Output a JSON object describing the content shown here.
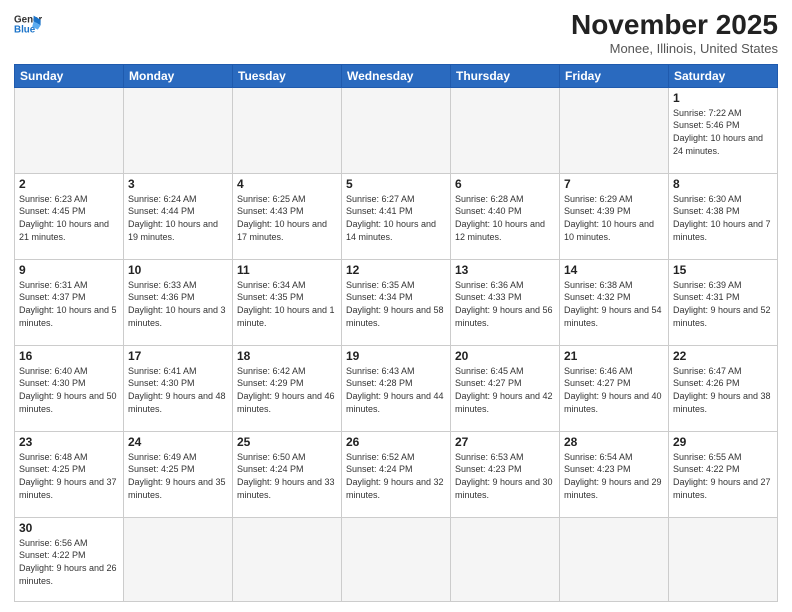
{
  "header": {
    "logo_general": "General",
    "logo_blue": "Blue",
    "month_title": "November 2025",
    "location": "Monee, Illinois, United States"
  },
  "weekdays": [
    "Sunday",
    "Monday",
    "Tuesday",
    "Wednesday",
    "Thursday",
    "Friday",
    "Saturday"
  ],
  "weeks": [
    [
      {
        "day": "",
        "info": ""
      },
      {
        "day": "",
        "info": ""
      },
      {
        "day": "",
        "info": ""
      },
      {
        "day": "",
        "info": ""
      },
      {
        "day": "",
        "info": ""
      },
      {
        "day": "",
        "info": ""
      },
      {
        "day": "1",
        "info": "Sunrise: 7:22 AM\nSunset: 5:46 PM\nDaylight: 10 hours and 24 minutes."
      }
    ],
    [
      {
        "day": "2",
        "info": "Sunrise: 6:23 AM\nSunset: 4:45 PM\nDaylight: 10 hours and 21 minutes."
      },
      {
        "day": "3",
        "info": "Sunrise: 6:24 AM\nSunset: 4:44 PM\nDaylight: 10 hours and 19 minutes."
      },
      {
        "day": "4",
        "info": "Sunrise: 6:25 AM\nSunset: 4:43 PM\nDaylight: 10 hours and 17 minutes."
      },
      {
        "day": "5",
        "info": "Sunrise: 6:27 AM\nSunset: 4:41 PM\nDaylight: 10 hours and 14 minutes."
      },
      {
        "day": "6",
        "info": "Sunrise: 6:28 AM\nSunset: 4:40 PM\nDaylight: 10 hours and 12 minutes."
      },
      {
        "day": "7",
        "info": "Sunrise: 6:29 AM\nSunset: 4:39 PM\nDaylight: 10 hours and 10 minutes."
      },
      {
        "day": "8",
        "info": "Sunrise: 6:30 AM\nSunset: 4:38 PM\nDaylight: 10 hours and 7 minutes."
      }
    ],
    [
      {
        "day": "9",
        "info": "Sunrise: 6:31 AM\nSunset: 4:37 PM\nDaylight: 10 hours and 5 minutes."
      },
      {
        "day": "10",
        "info": "Sunrise: 6:33 AM\nSunset: 4:36 PM\nDaylight: 10 hours and 3 minutes."
      },
      {
        "day": "11",
        "info": "Sunrise: 6:34 AM\nSunset: 4:35 PM\nDaylight: 10 hours and 1 minute."
      },
      {
        "day": "12",
        "info": "Sunrise: 6:35 AM\nSunset: 4:34 PM\nDaylight: 9 hours and 58 minutes."
      },
      {
        "day": "13",
        "info": "Sunrise: 6:36 AM\nSunset: 4:33 PM\nDaylight: 9 hours and 56 minutes."
      },
      {
        "day": "14",
        "info": "Sunrise: 6:38 AM\nSunset: 4:32 PM\nDaylight: 9 hours and 54 minutes."
      },
      {
        "day": "15",
        "info": "Sunrise: 6:39 AM\nSunset: 4:31 PM\nDaylight: 9 hours and 52 minutes."
      }
    ],
    [
      {
        "day": "16",
        "info": "Sunrise: 6:40 AM\nSunset: 4:30 PM\nDaylight: 9 hours and 50 minutes."
      },
      {
        "day": "17",
        "info": "Sunrise: 6:41 AM\nSunset: 4:30 PM\nDaylight: 9 hours and 48 minutes."
      },
      {
        "day": "18",
        "info": "Sunrise: 6:42 AM\nSunset: 4:29 PM\nDaylight: 9 hours and 46 minutes."
      },
      {
        "day": "19",
        "info": "Sunrise: 6:43 AM\nSunset: 4:28 PM\nDaylight: 9 hours and 44 minutes."
      },
      {
        "day": "20",
        "info": "Sunrise: 6:45 AM\nSunset: 4:27 PM\nDaylight: 9 hours and 42 minutes."
      },
      {
        "day": "21",
        "info": "Sunrise: 6:46 AM\nSunset: 4:27 PM\nDaylight: 9 hours and 40 minutes."
      },
      {
        "day": "22",
        "info": "Sunrise: 6:47 AM\nSunset: 4:26 PM\nDaylight: 9 hours and 38 minutes."
      }
    ],
    [
      {
        "day": "23",
        "info": "Sunrise: 6:48 AM\nSunset: 4:25 PM\nDaylight: 9 hours and 37 minutes."
      },
      {
        "day": "24",
        "info": "Sunrise: 6:49 AM\nSunset: 4:25 PM\nDaylight: 9 hours and 35 minutes."
      },
      {
        "day": "25",
        "info": "Sunrise: 6:50 AM\nSunset: 4:24 PM\nDaylight: 9 hours and 33 minutes."
      },
      {
        "day": "26",
        "info": "Sunrise: 6:52 AM\nSunset: 4:24 PM\nDaylight: 9 hours and 32 minutes."
      },
      {
        "day": "27",
        "info": "Sunrise: 6:53 AM\nSunset: 4:23 PM\nDaylight: 9 hours and 30 minutes."
      },
      {
        "day": "28",
        "info": "Sunrise: 6:54 AM\nSunset: 4:23 PM\nDaylight: 9 hours and 29 minutes."
      },
      {
        "day": "29",
        "info": "Sunrise: 6:55 AM\nSunset: 4:22 PM\nDaylight: 9 hours and 27 minutes."
      }
    ],
    [
      {
        "day": "30",
        "info": "Sunrise: 6:56 AM\nSunset: 4:22 PM\nDaylight: 9 hours and 26 minutes."
      },
      {
        "day": "",
        "info": ""
      },
      {
        "day": "",
        "info": ""
      },
      {
        "day": "",
        "info": ""
      },
      {
        "day": "",
        "info": ""
      },
      {
        "day": "",
        "info": ""
      },
      {
        "day": "",
        "info": ""
      }
    ]
  ]
}
